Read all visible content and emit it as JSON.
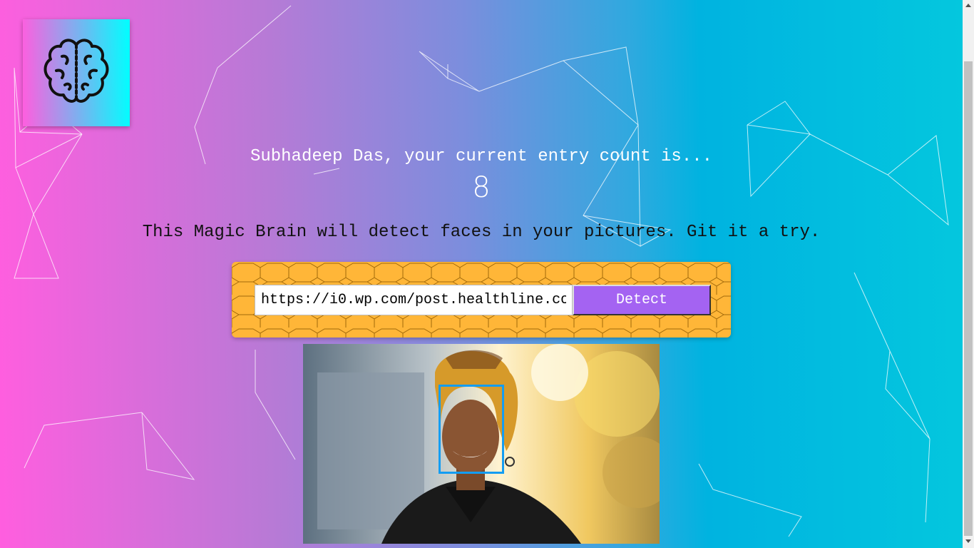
{
  "logo": {
    "icon": "brain-icon"
  },
  "rank": {
    "text": "Subhadeep Das, your current entry count is...",
    "count": "8"
  },
  "intro": {
    "text": "This Magic Brain will detect faces in your pictures. Git it a try."
  },
  "form": {
    "input_value": "https://i0.wp.com/post.healthline.co",
    "detect_label": "Detect",
    "panel_color": "#ffb638",
    "button_color": "#a463f2"
  },
  "result": {
    "image": "woman-in-headwrap-photo",
    "box_color": "#149df2"
  },
  "colors": {
    "gradient_start": "#ff5edf",
    "gradient_end": "#04c8de"
  }
}
